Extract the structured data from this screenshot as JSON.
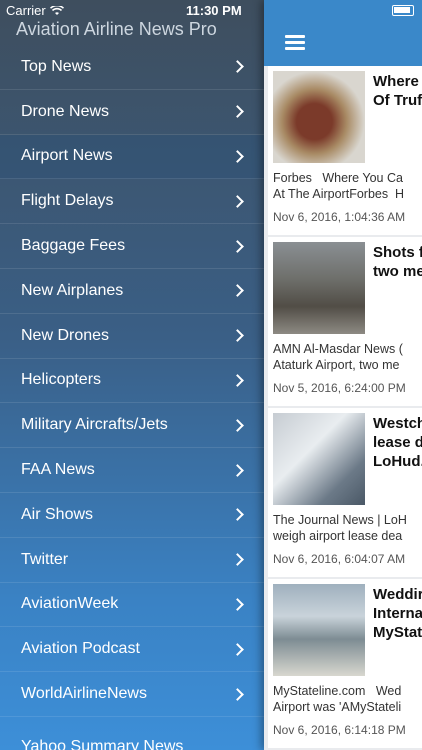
{
  "status": {
    "carrier": "Carrier",
    "time": "11:30 PM"
  },
  "sidebar": {
    "title": "Aviation Airline News Pro",
    "items": [
      {
        "label": "Top News"
      },
      {
        "label": "Drone News"
      },
      {
        "label": "Airport News"
      },
      {
        "label": "Flight Delays"
      },
      {
        "label": "Baggage Fees"
      },
      {
        "label": "New Airplanes"
      },
      {
        "label": "New Drones"
      },
      {
        "label": "Helicopters"
      },
      {
        "label": "Military Aircrafts/Jets"
      },
      {
        "label": "FAA News"
      },
      {
        "label": "Air Shows"
      },
      {
        "label": "Twitter"
      },
      {
        "label": "AviationWeek"
      },
      {
        "label": "Aviation Podcast"
      },
      {
        "label": "WorldAirlineNews"
      }
    ],
    "partial_item": "Yahoo Summary News"
  },
  "feed": [
    {
      "title": "Where\nOf Truf",
      "desc": "Forbes   Where You Ca\nAt The AirportForbes  H",
      "date": "Nov 6, 2016, 1:04:36 AM"
    },
    {
      "title": "Shots f\ntwo me",
      "desc": "AMN Al-Masdar News (\nAtaturk Airport, two me",
      "date": "Nov 5, 2016, 6:24:00 PM"
    },
    {
      "title": "Westch\nlease d\nLoHud.",
      "desc": "The Journal News | LoH\nweigh airport lease dea",
      "date": "Nov 6, 2016, 6:04:07 AM"
    },
    {
      "title": "Weddir\nInterna\nMyStat",
      "desc": "MyStateline.com   Wed\nAirport was 'AMyStateli",
      "date": "Nov 6, 2016, 6:14:18 PM"
    }
  ]
}
